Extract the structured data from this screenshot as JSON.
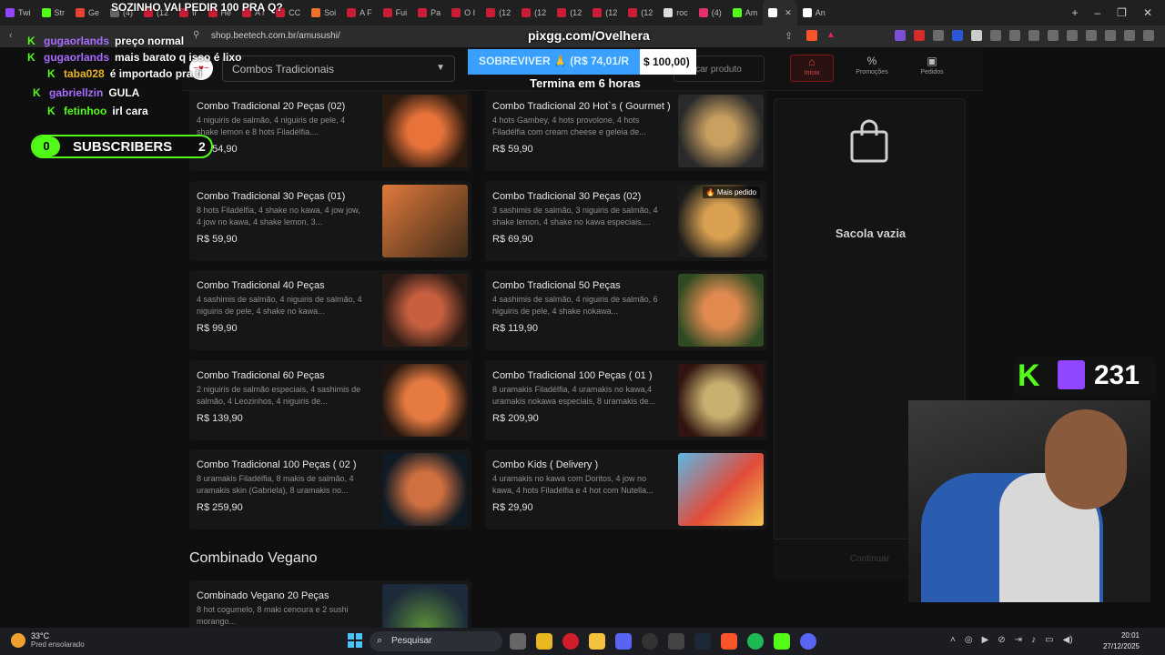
{
  "browser": {
    "tabs": [
      {
        "label": "Twi",
        "color": "#9146ff"
      },
      {
        "label": "Str",
        "color": "#53fc18"
      },
      {
        "label": "Ge",
        "color": "#ea4335"
      },
      {
        "label": "(4)",
        "color": "#666666"
      },
      {
        "label": "(12",
        "color": "#c81d35"
      },
      {
        "label": "Ir",
        "color": "#c81d35"
      },
      {
        "label": "He",
        "color": "#c81d35"
      },
      {
        "label": "A r",
        "color": "#c81d35"
      },
      {
        "label": "CC",
        "color": "#c81d35"
      },
      {
        "label": "Soi",
        "color": "#f07030"
      },
      {
        "label": "A F",
        "color": "#c81d35"
      },
      {
        "label": "Fui",
        "color": "#c81d35"
      },
      {
        "label": "Pa",
        "color": "#c81d35"
      },
      {
        "label": "O I",
        "color": "#c81d35"
      },
      {
        "label": "(12",
        "color": "#c81d35"
      },
      {
        "label": "(12",
        "color": "#c81d35"
      },
      {
        "label": "(12",
        "color": "#c81d35"
      },
      {
        "label": "(12",
        "color": "#c81d35"
      },
      {
        "label": "(12",
        "color": "#c81d35"
      },
      {
        "label": "roc",
        "color": "#dddddd"
      },
      {
        "label": "(4)",
        "color": "#e1306c"
      },
      {
        "label": "Am",
        "color": "#53fc18"
      },
      {
        "label": "",
        "color": "#ffffff",
        "active": true
      },
      {
        "label": "An",
        "color": "#ffffff"
      }
    ],
    "url": "shop.beetech.com.br/amusushi/"
  },
  "site": {
    "logo_text": "~♥~",
    "category_select": "Combos Tradicionais",
    "search_placeholder": "Buscar produto",
    "nav": [
      {
        "label": "Início",
        "icon": "home-icon",
        "active": true
      },
      {
        "label": "Promoções",
        "icon": "discount-icon",
        "active": false
      },
      {
        "label": "Pedidos",
        "icon": "bag-icon",
        "active": false
      }
    ],
    "products": [
      {
        "name": "Combo Tradicional 20 Peças (02)",
        "desc": "4 niguiris de salmão, 4 niguiris de pele, 4 shake lemon e 8 hots Filadélfia....",
        "price": "R$ 54,90",
        "badge": ""
      },
      {
        "name": "Combo Tradicional 20 Hot`s ( Gourmet )",
        "desc": "4 hots Gambey, 4 hots provolone, 4 hots Filadélfia com cream cheese e geleia de...",
        "price": "R$ 59,90",
        "badge": ""
      },
      {
        "name": "Combo Tradicional 30 Peças (01)",
        "desc": "8 hots Filadélfia, 4 shake no kawa, 4 jow jow, 4 jow no kawa, 4 shake lemon, 3...",
        "price": "R$ 59,90",
        "badge": ""
      },
      {
        "name": "Combo Tradicional 30 Peças (02)",
        "desc": "3 sashimis de salmão, 3 niguiris de salmão, 4 shake lemon, 4 shake no kawa especiais,...",
        "price": "R$ 69,90",
        "badge": "🔥 Mais pedido"
      },
      {
        "name": "Combo Tradicional 40 Peças",
        "desc": "4 sashimis de salmão, 4 niguiris de salmão, 4 niguiris de pele, 4 shake no kawa...",
        "price": "R$ 99,90",
        "badge": ""
      },
      {
        "name": "Combo Tradicional 50 Peças",
        "desc": "4 sashimis de salmão, 4 niguiris de salmão, 6 niguiris de pele, 4 shake nokawa...",
        "price": "R$ 119,90",
        "badge": ""
      },
      {
        "name": "Combo Tradicional 60 Peças",
        "desc": "2 niguiris de salmão especiais, 4 sashimis de salmão, 4 Leozinhos, 4 niguiris de...",
        "price": "R$ 139,90",
        "badge": ""
      },
      {
        "name": "Combo Tradicional 100 Peças ( 01 )",
        "desc": "8 uramakis Filadélfia, 4 uramakis no kawa,4 uramakis nokawa especiais, 8 uramakis de...",
        "price": "R$ 209,90",
        "badge": ""
      },
      {
        "name": "Combo Tradicional 100 Peças ( 02 )",
        "desc": "8 uramakis Filadélfia, 8 makis de salmão, 4 uramakis skin (Gabriela), 8 uramakis no...",
        "price": "R$ 259,90",
        "badge": ""
      },
      {
        "name": "Combo Kids ( Delivery )",
        "desc": "4 uramakis no kawa com Doritos, 4 jow no kawa, 4 hots Filadélfia e 4 hot com Nutella...",
        "price": "R$ 29,90",
        "badge": ""
      }
    ],
    "section_title": "Combinado Vegano",
    "vegan_product": {
      "name": "Combinado Vegano 20 Peças",
      "desc": "8 hot cogumelo, 8 maki cenoura e 2 sushi morango...",
      "price": ""
    },
    "bag": {
      "empty_text": "Sacola vazia",
      "continue_label": "Continuar"
    }
  },
  "stream": {
    "top_text": "SOZINHO VAI PEDIR 100 PRA Q?",
    "chat": [
      {
        "user": "gugaorlands",
        "msg": "preço normal",
        "color": "purple"
      },
      {
        "user": "gugaorlands",
        "msg": "mais barato q isso é lixo",
        "color": "purple"
      },
      {
        "user": "taba028",
        "msg": "é importado pra ti",
        "color": "gold"
      },
      {
        "user": "gabriellzin",
        "msg": "GULA",
        "color": "purple"
      },
      {
        "user": "fetinhoo",
        "msg": "irl cara",
        "color": "green"
      }
    ],
    "subs": {
      "count": "0",
      "label": "SUBSCRIBERS",
      "goal": "2"
    },
    "pix": "pixgg.com/Ovelhera",
    "donation": {
      "text": "SOBREVIVER 🙏 (R$ 74,01/R",
      "goal": "$ 100,00)"
    },
    "ends": "Termina em 6 horas",
    "viewers": "231"
  },
  "taskbar": {
    "temp": "33°C",
    "weather": "Pred ensolarado",
    "search": "Pesquisar",
    "time": "20:01",
    "date": "27/12/2025"
  }
}
